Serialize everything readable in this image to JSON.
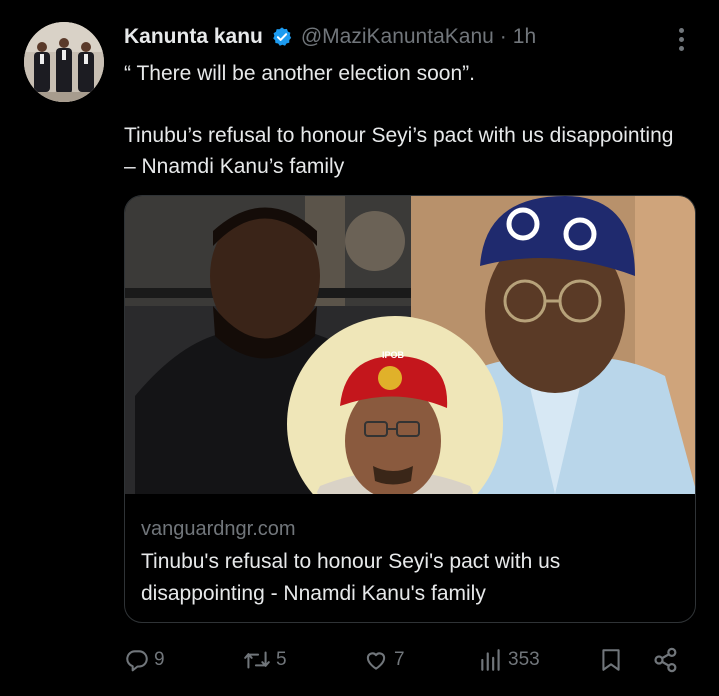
{
  "tweet": {
    "author_name": "Kanunta kanu",
    "handle": "@MaziKanuntaKanu",
    "separator": "·",
    "time": "1h",
    "text_line1": "“ There will be another election soon”.",
    "text_line2": "Tinubu’s refusal to honour Seyi’s pact with us disappointing – Nnamdi Kanu’s family"
  },
  "link_card": {
    "domain": "vanguardngr.com",
    "title": "Tinubu's refusal to honour Seyi's pact with us disappointing - Nnamdi Kanu's family",
    "image_cap_text": "IPOB"
  },
  "actions": {
    "replies": "9",
    "reposts": "5",
    "likes": "7",
    "views": "353"
  },
  "icons": [
    "verified-badge-icon",
    "more-icon",
    "reply-icon",
    "repost-icon",
    "like-icon",
    "views-icon",
    "bookmark-icon",
    "share-icon"
  ],
  "colors": {
    "background": "#000000",
    "primary_text": "#e7e9ea",
    "secondary_text": "#71767b",
    "verified": "#1d9bf0",
    "border": "#2f3336"
  }
}
